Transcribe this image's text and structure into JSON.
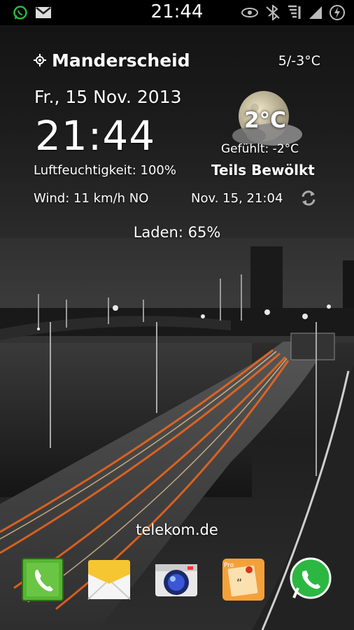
{
  "status_bar": {
    "time": "21:44",
    "left_icons": [
      "whatsapp-icon",
      "gmail-icon"
    ],
    "right_icons": [
      "eye-icon",
      "bluetooth-off-icon",
      "signal-alt-icon",
      "signal-icon",
      "power-saving-icon"
    ]
  },
  "weather": {
    "location": "Manderscheid",
    "temp_range": "5/-3°C",
    "date": "Fr., 15 Nov. 2013",
    "time": "21:44",
    "humidity": "Luftfeuchtigkeit: 100%",
    "wind": "Wind: 11 km/h NO",
    "updated": "Nov. 15, 21:04",
    "temperature": "2°C",
    "feels_like": "Gefühlt: -2°C",
    "condition": "Teils Bewölkt",
    "battery": "Laden: 65%",
    "icon": "moon-cloud-icon"
  },
  "carrier": "telekom.de",
  "dock": {
    "apps": [
      "phone-app",
      "messages-app",
      "camera-app",
      "notes-pro-app",
      "whatsapp-app"
    ]
  },
  "colors": {
    "phone_green": "#55b630",
    "messages_yellow": "#f6c532",
    "whatsapp_green": "#2cb742",
    "light_trail": "#ff6a1a"
  }
}
